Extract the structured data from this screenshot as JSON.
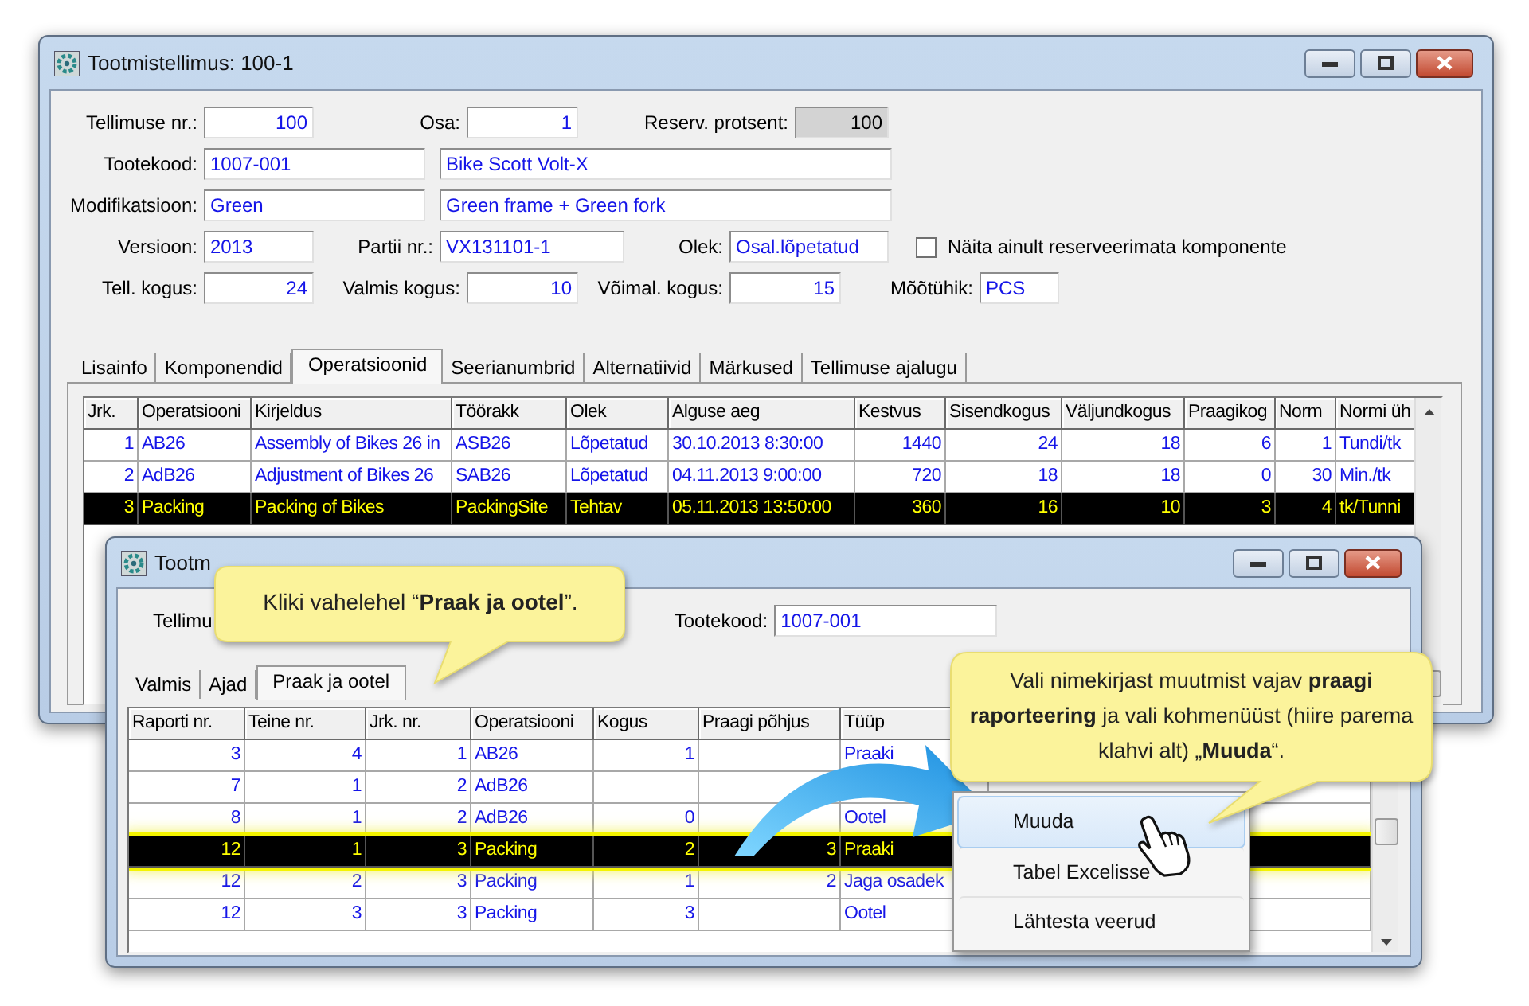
{
  "main_window": {
    "title": "Tootmistellimus: 100-1",
    "order_no": {
      "label": "Tellimuse nr.:",
      "value": "100"
    },
    "part": {
      "label": "Osa:",
      "value": "1"
    },
    "reserve_percent": {
      "label": "Reserv. protsent:",
      "value": "100",
      "disabled": true
    },
    "product_code": {
      "label": "Tootekood:",
      "value": "1007-001"
    },
    "product_name": {
      "value": "Bike Scott Volt-X"
    },
    "modification": {
      "label": "Modifikatsioon:",
      "value": "Green"
    },
    "modification_desc": {
      "value": "Green frame + Green fork"
    },
    "version": {
      "label": "Versioon:",
      "value": "2013"
    },
    "batch": {
      "label": "Partii nr.:",
      "value": "VX131101-1"
    },
    "status": {
      "label": "Olek:",
      "value": "Osal.lõpetatud"
    },
    "unreserved_only": {
      "label": "Näita ainult reserveerimata komponente",
      "checked": false
    },
    "order_qty": {
      "label": "Tell. kogus:",
      "value": "24"
    },
    "done_qty": {
      "label": "Valmis kogus:",
      "value": "10"
    },
    "possible_qty": {
      "label": "Võimal. kogus:",
      "value": "15"
    },
    "unit": {
      "label": "Mõõtühik:",
      "value": "PCS"
    },
    "tabs": [
      {
        "label": "Lisainfo",
        "selected": false
      },
      {
        "label": "Komponendid",
        "selected": false
      },
      {
        "label": "Operatsioonid",
        "selected": true
      },
      {
        "label": "Seerianumbrid",
        "selected": false
      },
      {
        "label": "Alternatiivid",
        "selected": false
      },
      {
        "label": "Märkused",
        "selected": false
      },
      {
        "label": "Tellimuse ajalugu",
        "selected": false
      }
    ],
    "grid": {
      "columns": [
        {
          "label": "Jrk."
        },
        {
          "label": "Operatsiooni"
        },
        {
          "label": "Kirjeldus"
        },
        {
          "label": "Töörakk"
        },
        {
          "label": "Olek"
        },
        {
          "label": "Alguse aeg"
        },
        {
          "label": "Kestvus"
        },
        {
          "label": "Sisendkogus"
        },
        {
          "label": "Väljundkogus"
        },
        {
          "label": "Praagikog"
        },
        {
          "label": "Norm"
        },
        {
          "label": "Normi üh"
        }
      ],
      "rows": [
        {
          "selected": false,
          "cells": [
            "1",
            "AB26",
            "Assembly of Bikes 26 in",
            "ASB26",
            "Lõpetatud",
            "30.10.2013 8:30:00",
            "1440",
            "24",
            "18",
            "6",
            "1",
            "Tundi/tk"
          ]
        },
        {
          "selected": false,
          "cells": [
            "2",
            "AdB26",
            "Adjustment of Bikes 26",
            "SAB26",
            "Lõpetatud",
            "04.11.2013 9:00:00",
            "720",
            "18",
            "18",
            "0",
            "30",
            "Min./tk"
          ]
        },
        {
          "selected": true,
          "cells": [
            "3",
            "Packing",
            "Packing of Bikes",
            "PackingSite",
            "Tehtav",
            "05.11.2013 13:50:00",
            "360",
            "16",
            "10",
            "3",
            "4",
            "tk/Tunni"
          ]
        }
      ]
    }
  },
  "report_window": {
    "title": "Tootm",
    "order_label": "Tellimu",
    "product_code": {
      "label": "Tootekood:",
      "value": "1007-001"
    },
    "tabs": [
      {
        "label": "Valmis",
        "selected": false
      },
      {
        "label": "Ajad",
        "selected": false
      },
      {
        "label": "Praak ja ootel",
        "selected": true
      }
    ],
    "grid": {
      "columns": [
        {
          "label": "Raporti nr."
        },
        {
          "label": "Teine nr."
        },
        {
          "label": "Jrk. nr."
        },
        {
          "label": "Operatsiooni"
        },
        {
          "label": "Kogus"
        },
        {
          "label": "Praagi põhjus"
        },
        {
          "label": "Tüüp"
        }
      ],
      "rows": [
        {
          "selected": false,
          "cells": [
            "3",
            "4",
            "1",
            "AB26",
            "1",
            "",
            "Praaki"
          ]
        },
        {
          "selected": false,
          "cells": [
            "7",
            "1",
            "2",
            "AdB26",
            "",
            "",
            ""
          ]
        },
        {
          "selected": false,
          "cells": [
            "8",
            "1",
            "2",
            "AdB26",
            "0",
            "",
            "Ootel"
          ]
        },
        {
          "selected": true,
          "cells": [
            "12",
            "1",
            "3",
            "Packing",
            "2",
            "3",
            "Praaki"
          ]
        },
        {
          "selected": false,
          "cells": [
            "12",
            "2",
            "3",
            "Packing",
            "1",
            "2",
            "Jaga osadek"
          ]
        },
        {
          "selected": false,
          "cells": [
            "12",
            "3",
            "3",
            "Packing",
            "3",
            "",
            "Ootel"
          ]
        }
      ]
    }
  },
  "context_menu": [
    {
      "label": "Muuda",
      "selected": true
    },
    {
      "label": "Tabel Excelisse",
      "selected": false
    },
    {
      "label": "Lähtesta veerud",
      "selected": false
    }
  ],
  "callouts": [
    {
      "text": "Kliki vahelehel “**Praak ja ootel**”."
    },
    {
      "text": "Vali nimekirjast muutmist vajav **praagi raporteering** ja vali kohmenüüst (hiire parema klahvi alt) „**Muuda**“."
    }
  ]
}
